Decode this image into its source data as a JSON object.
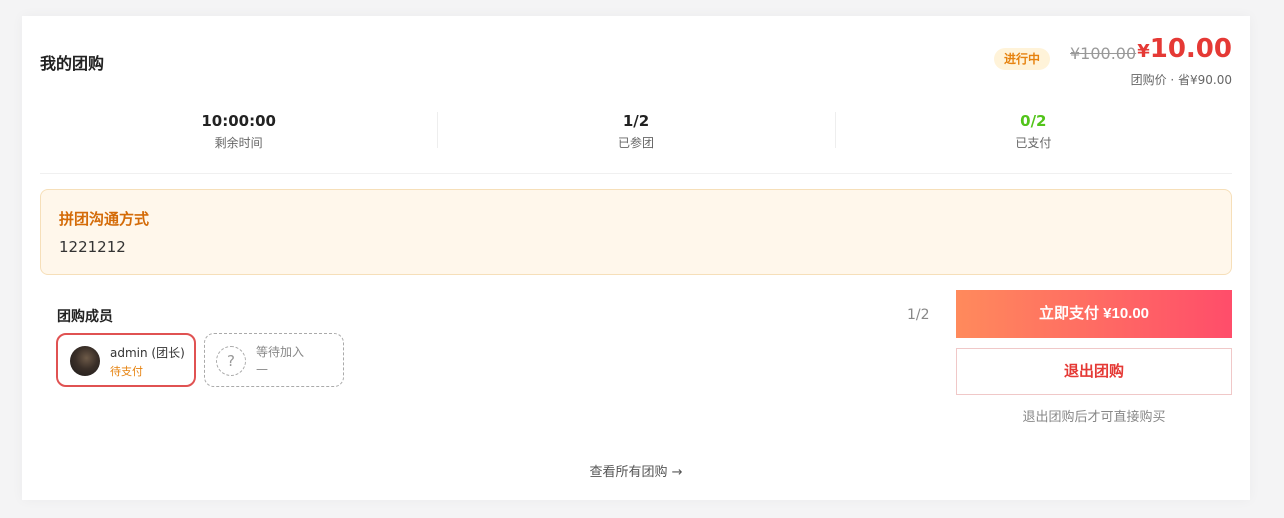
{
  "header": {
    "title": "我的团购",
    "status": "进行中",
    "original_price": "¥100.00",
    "price_currency": "¥",
    "price_value": "10.00",
    "price_note": "团购价 · 省¥90.00"
  },
  "stats": [
    {
      "value": "10:00:00",
      "label": "剩余时间"
    },
    {
      "value": "1/2",
      "label": "已参团"
    },
    {
      "value": "0/2",
      "label": "已支付"
    }
  ],
  "contact": {
    "title": "拼团沟通方式",
    "value": "1221212"
  },
  "members": {
    "title": "团购成员",
    "count": "1/2",
    "list": [
      {
        "name": "admin (团长)",
        "status": "待支付"
      },
      {
        "name": "等待加入",
        "status": "—"
      }
    ]
  },
  "actions": {
    "pay_label": "立即支付 ¥10.00",
    "exit_label": "退出团购",
    "exit_hint": "退出团购后才可直接购买"
  },
  "footer": {
    "view_all": "查看所有团购 →"
  },
  "colors": {
    "price_red": "#e53935",
    "status_orange": "#e6820e",
    "paid_green": "#52c41a",
    "contact_title": "#d46b08"
  },
  "icons": {
    "waiting_member": "question-icon",
    "leader_avatar": "avatar"
  }
}
